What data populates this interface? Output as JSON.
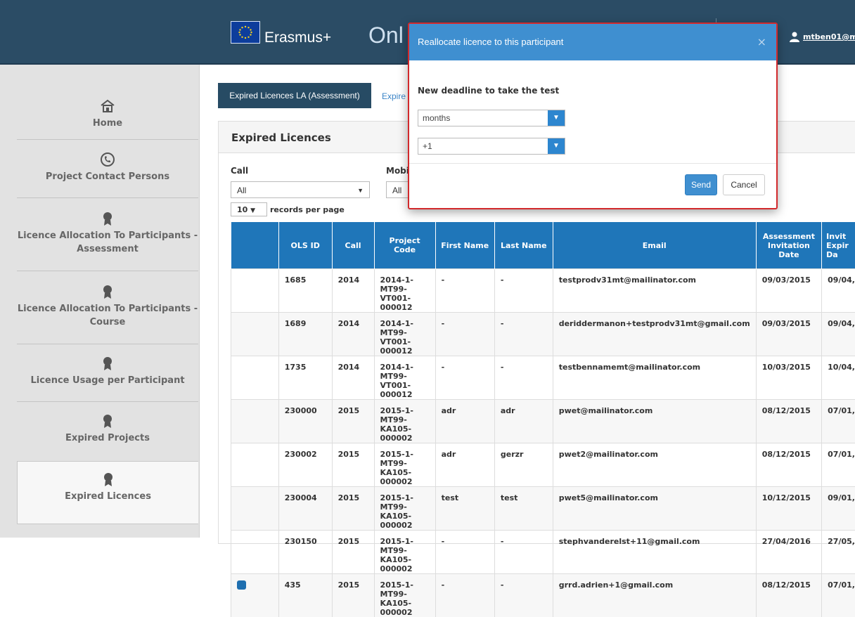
{
  "header": {
    "brand": "Erasmus+",
    "app_title": "Onl",
    "user_email": "mtben01@ma"
  },
  "sidebar": {
    "items": [
      {
        "label": "Home",
        "icon": "home-icon"
      },
      {
        "label": "Project Contact Persons",
        "icon": "phone-icon"
      },
      {
        "label": "Licence Allocation To Participants - Assessment",
        "icon": "award-icon"
      },
      {
        "label": "Licence Allocation To Participants - Course",
        "icon": "award-icon"
      },
      {
        "label": "Licence Usage per Participant",
        "icon": "award-icon"
      },
      {
        "label": "Expired Projects",
        "icon": "award-icon"
      },
      {
        "label": "Expired Licences",
        "icon": "award-icon"
      }
    ]
  },
  "tabs": {
    "active": "Expired Licences LA (Assessment)",
    "second": "Expire"
  },
  "panel": {
    "title": "Expired Licences",
    "filters": {
      "call_label": "Call",
      "call_value": "All",
      "mobility_label": "Mobi",
      "mobility_value": "All"
    },
    "records": {
      "value": "10",
      "label": "records per page"
    }
  },
  "table": {
    "headers": [
      "",
      "OLS ID",
      "Call",
      "Project Code",
      "First Name",
      "Last Name",
      "Email",
      "Assessment Invitation Date",
      "Invit Expir Da"
    ],
    "rows": [
      {
        "action": false,
        "ols": "1685",
        "call": "2014",
        "code": "2014-1-MT99-VT001-000012",
        "first": "-",
        "last": "-",
        "email": "testprodv31mt@mailinator.com",
        "inv": "09/03/2015",
        "exp": "09/04,"
      },
      {
        "action": false,
        "ols": "1689",
        "call": "2014",
        "code": "2014-1-MT99-VT001-000012",
        "first": "-",
        "last": "-",
        "email": "deriddermanon+testprodv31mt@gmail.com",
        "inv": "09/03/2015",
        "exp": "09/04,"
      },
      {
        "action": false,
        "ols": "1735",
        "call": "2014",
        "code": "2014-1-MT99-VT001-000012",
        "first": "-",
        "last": "-",
        "email": "testbennamemt@mailinator.com",
        "inv": "10/03/2015",
        "exp": "10/04,"
      },
      {
        "action": false,
        "ols": "230000",
        "call": "2015",
        "code": "2015-1-MT99-KA105-000002",
        "first": "adr",
        "last": "adr",
        "email": "pwet@mailinator.com",
        "inv": "08/12/2015",
        "exp": "07/01,"
      },
      {
        "action": false,
        "ols": "230002",
        "call": "2015",
        "code": "2015-1-MT99-KA105-000002",
        "first": "adr",
        "last": "gerzr",
        "email": "pwet2@mailinator.com",
        "inv": "08/12/2015",
        "exp": "07/01,"
      },
      {
        "action": false,
        "ols": "230004",
        "call": "2015",
        "code": "2015-1-MT99-KA105-000002",
        "first": "test",
        "last": "test",
        "email": "pwet5@mailinator.com",
        "inv": "10/12/2015",
        "exp": "09/01,"
      },
      {
        "action": false,
        "ols": "230150",
        "call": "2015",
        "code": "2015-1-MT99-KA105-000002",
        "first": "-",
        "last": "-",
        "email": "stephvanderelst+11@gmail.com",
        "inv": "27/04/2016",
        "exp": "27/05,"
      },
      {
        "action": true,
        "ols": "435",
        "call": "2015",
        "code": "2015-1-MT99-KA105-000002",
        "first": "-",
        "last": "-",
        "email": "grrd.adrien+1@gmail.com",
        "inv": "08/12/2015",
        "exp": "07/01,"
      }
    ]
  },
  "modal": {
    "title": "Reallocate licence to this participant",
    "close": "×",
    "label": "New deadline to take the test",
    "unit_value": "months",
    "amount_value": "+1",
    "send_label": "Send",
    "cancel_label": "Cancel"
  },
  "colors": {
    "header_bg": "#2b4c65",
    "table_header": "#1f76b9",
    "modal_header": "#3f8fd0",
    "modal_border": "#d2292c"
  }
}
